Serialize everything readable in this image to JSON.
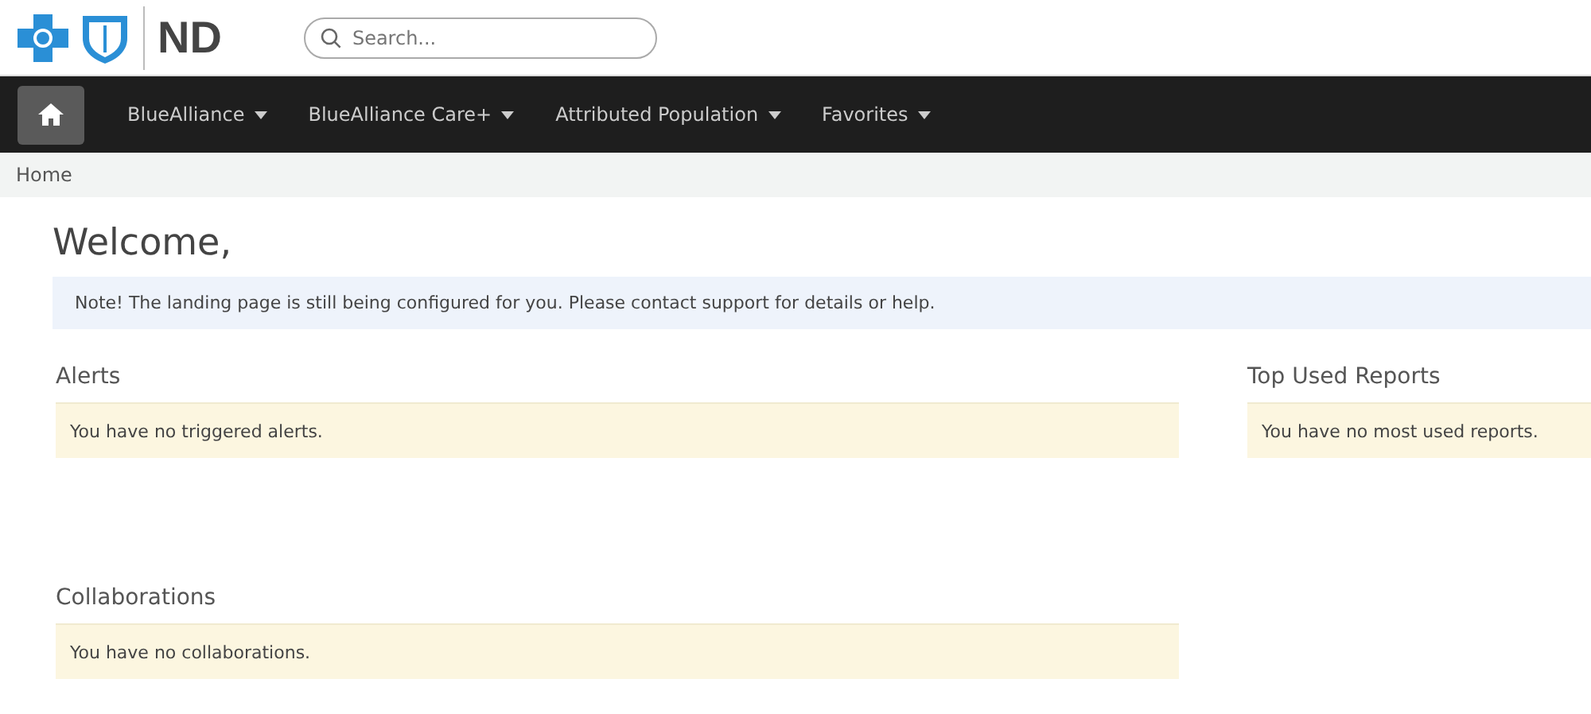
{
  "header": {
    "logo_text": "ND",
    "search": {
      "placeholder": "Search..."
    }
  },
  "nav": {
    "items": [
      {
        "label": "BlueAlliance"
      },
      {
        "label": "BlueAlliance Care+"
      },
      {
        "label": "Attributed Population"
      },
      {
        "label": "Favorites"
      }
    ]
  },
  "breadcrumb": "Home",
  "title": "Welcome,",
  "note": "Note! The landing page is still being configured for you. Please contact support for details or help.",
  "panels": [
    {
      "heading": "Alerts",
      "message": "You have no triggered alerts."
    },
    {
      "heading": "Top Used Reports",
      "message": "You have no most used reports."
    },
    {
      "heading": "Collaborations",
      "message": "You have no collaborations."
    }
  ]
}
